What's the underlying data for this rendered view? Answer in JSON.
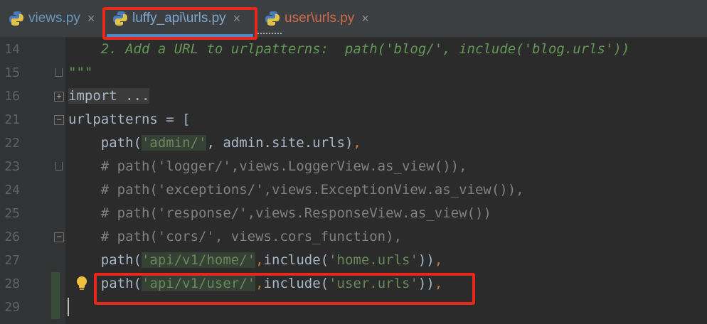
{
  "tabs": [
    {
      "label": "views.py",
      "close": "×"
    },
    {
      "label": "luffy_api\\urls.py",
      "close": "×"
    },
    {
      "label": "user\\urls.py",
      "close": "×"
    }
  ],
  "editor": {
    "lines": [
      {
        "num": "14",
        "parts": [
          {
            "t": "    2. Add a URL to urlpatterns:  path('blog/', include('blog.urls'))",
            "c": "doc"
          }
        ]
      },
      {
        "num": "15",
        "parts": [
          {
            "t": "\"\"\"",
            "c": "doc"
          }
        ]
      },
      {
        "num": "16",
        "parts": [
          {
            "t": "import ...",
            "c": "fold-region"
          }
        ]
      },
      {
        "num": "21",
        "parts": [
          {
            "t": "urlpatterns = [",
            "c": ""
          }
        ]
      },
      {
        "num": "22",
        "parts": [
          {
            "t": "    path(",
            "c": ""
          },
          {
            "t": "'admin/'",
            "c": "str hl-bg"
          },
          {
            "t": ", admin.site.urls",
            "c": ""
          },
          {
            "t": ")",
            "c": ""
          },
          {
            "t": ",",
            "c": "kw"
          }
        ]
      },
      {
        "num": "23",
        "parts": [
          {
            "t": "    # path('logger/',views.LoggerView.as_view()),",
            "c": "com"
          }
        ]
      },
      {
        "num": "24",
        "parts": [
          {
            "t": "    # path('exceptions/',views.ExceptionView.as_view()),",
            "c": "com"
          }
        ]
      },
      {
        "num": "25",
        "parts": [
          {
            "t": "    # path('response/',views.ResponseView.as_view())",
            "c": "com"
          }
        ]
      },
      {
        "num": "26",
        "parts": [
          {
            "t": "    # path('cors/', views.cors_function),",
            "c": "com"
          }
        ]
      },
      {
        "num": "27",
        "parts": [
          {
            "t": "    path(",
            "c": ""
          },
          {
            "t": "'api/v1/home/'",
            "c": "str hl-bg"
          },
          {
            "t": ",",
            "c": "kw"
          },
          {
            "t": "include(",
            "c": ""
          },
          {
            "t": "'home.urls'",
            "c": "str"
          },
          {
            "t": "))",
            "c": ""
          },
          {
            "t": ",",
            "c": "kw"
          }
        ]
      },
      {
        "num": "28",
        "parts": [
          {
            "t": "    path(",
            "c": ""
          },
          {
            "t": "'api/v1/user/'",
            "c": "str hl-bg"
          },
          {
            "t": ",",
            "c": "kw"
          },
          {
            "t": "include(",
            "c": ""
          },
          {
            "t": "'user.urls'",
            "c": "str"
          },
          {
            "t": "))",
            "c": ""
          },
          {
            "t": ",",
            "c": "kw"
          }
        ]
      },
      {
        "num": "29",
        "parts": [
          {
            "t": "",
            "c": ""
          }
        ]
      }
    ]
  },
  "icons": {
    "tab_file": "python-file-icon",
    "intention": "lightbulb-icon"
  },
  "colors": {
    "annotation": "#e8271d",
    "active_tab_underline": "#4a88c7"
  }
}
